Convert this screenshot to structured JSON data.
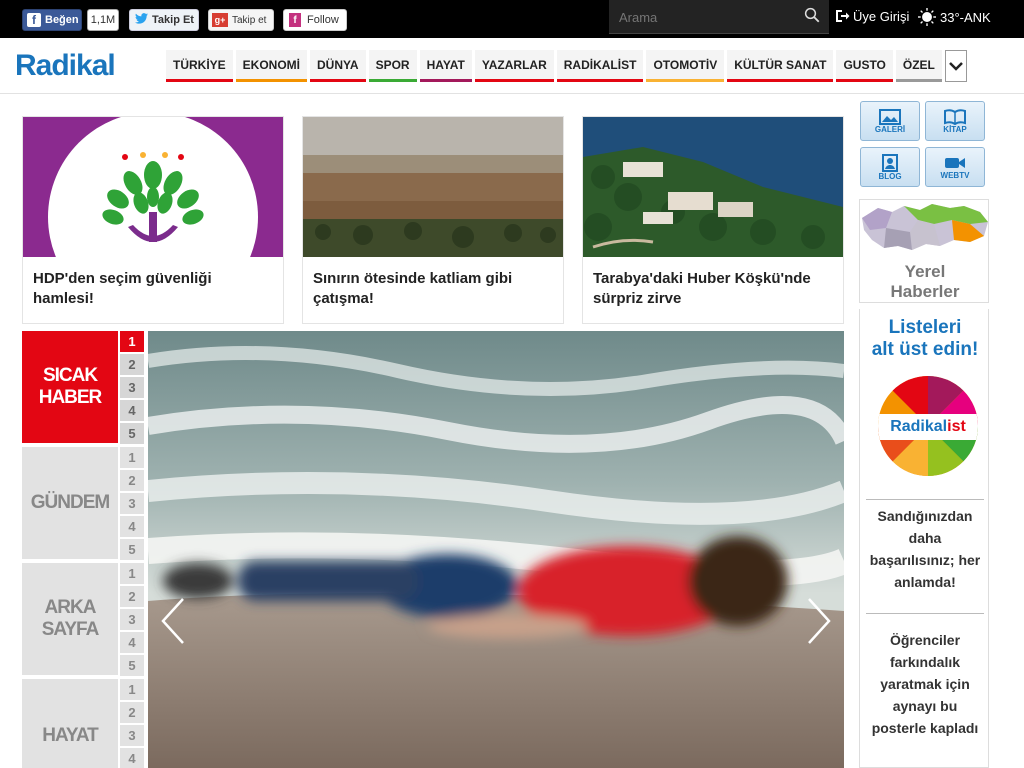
{
  "topbar": {
    "facebook_label": "Beğen",
    "facebook_count": "1,1M",
    "twitter_label": "Takip Et",
    "gplus_label": "Takip et",
    "follow_label": "Follow",
    "search_placeholder": "Arama",
    "login_label": "Üye Girişi",
    "weather_label": "33°-ANK"
  },
  "header": {
    "logo": "Radikal",
    "nav": [
      {
        "label": "TÜRKİYE",
        "color": "#e30613"
      },
      {
        "label": "EKONOMİ",
        "color": "#f39200"
      },
      {
        "label": "DÜNYA",
        "color": "#e30613"
      },
      {
        "label": "SPOR",
        "color": "#3aaa35"
      },
      {
        "label": "HAYAT",
        "color": "#a3195b"
      },
      {
        "label": "YAZARLAR",
        "color": "#e30613"
      },
      {
        "label": "RADİKALİST",
        "color": "#e30613"
      },
      {
        "label": "OTOMOTİV",
        "color": "#f9b233"
      },
      {
        "label": "KÜLTÜR SANAT",
        "color": "#e30613"
      },
      {
        "label": "GUSTO",
        "color": "#e30613"
      },
      {
        "label": "ÖZEL",
        "color": "#999999"
      }
    ]
  },
  "cards": [
    {
      "title": "HDP'den seçim güvenliği hamlesi!"
    },
    {
      "title": "Sınırın ötesinde katliam gibi çatışma!"
    },
    {
      "title": "Tarabya'daki Huber Köşkü'nde sürpriz zirve"
    }
  ],
  "tabs": [
    {
      "label_line1": "SICAK",
      "label_line2": "HABER",
      "active": true,
      "numbers": [
        "1",
        "2",
        "3",
        "4",
        "5"
      ]
    },
    {
      "label_line1": "GÜNDEM",
      "label_line2": "",
      "active": false,
      "numbers": [
        "1",
        "2",
        "3",
        "4",
        "5"
      ]
    },
    {
      "label_line1": "ARKA",
      "label_line2": "SAYFA",
      "active": false,
      "numbers": [
        "1",
        "2",
        "3",
        "4",
        "5"
      ]
    },
    {
      "label_line1": "HAYAT",
      "label_line2": "",
      "active": false,
      "numbers": [
        "1",
        "2",
        "3",
        "4"
      ]
    }
  ],
  "sidebar": {
    "buttons": [
      "GALERİ",
      "KİTAP",
      "BLOG",
      "WEBTV"
    ],
    "yerel_line1": "Yerel",
    "yerel_line2": "Haberler",
    "listeler_line1": "Listeleri",
    "listeler_line2": "alt üst edin!",
    "radikalist_logo_a": "Radikal",
    "radikalist_logo_b": "ist",
    "promo1": "Sandığınızdan daha başarılısınız; her anlamda!",
    "promo2": "Öğrenciler farkındalık yaratmak için aynayı bu posterle kapladı"
  }
}
